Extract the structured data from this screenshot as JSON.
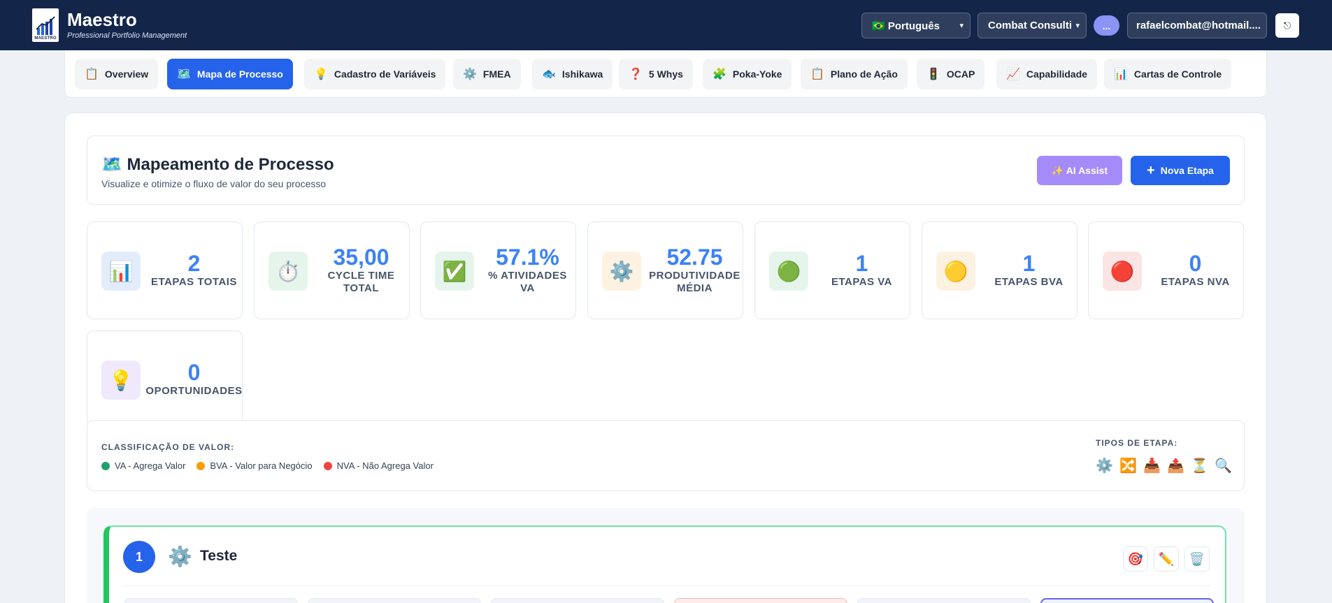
{
  "header": {
    "brand": "Maestro",
    "tagline": "Professional Portfolio Management",
    "logo_text": "MAESTRO",
    "language": "🇧🇷 Português",
    "company": "Combat Consulti",
    "more": "...",
    "email": "rafaelcombat@hotmail....",
    "logout_icon": "⎋"
  },
  "tabs": [
    {
      "icon": "📋",
      "label": "Overview"
    },
    {
      "icon": "🗺️",
      "label": "Mapa de Processo"
    },
    {
      "icon": "💡",
      "label": "Cadastro de Variáveis"
    },
    {
      "icon": "⚙️",
      "label": "FMEA"
    },
    {
      "icon": "🐟",
      "label": "Ishikawa"
    },
    {
      "icon": "❓",
      "label": "5 Whys"
    },
    {
      "icon": "🧩",
      "label": "Poka-Yoke"
    },
    {
      "icon": "📋",
      "label": "Plano de Ação"
    },
    {
      "icon": "🚦",
      "label": "OCAP"
    },
    {
      "icon": "📈",
      "label": "Capabilidade"
    },
    {
      "icon": "📊",
      "label": "Cartas de Controle"
    }
  ],
  "hero": {
    "title": "🗺️ Mapeamento de Processo",
    "subtitle": "Visualize e otimize o fluxo de valor do seu processo",
    "ai_button": "✨ AI Assist",
    "new_button_icon": "+",
    "new_button": "Nova Etapa"
  },
  "stats": [
    {
      "icon": "📊",
      "value": "2",
      "label": "ETAPAS TOTAIS"
    },
    {
      "icon": "⏱️",
      "value": "35,00",
      "label": "CYCLE TIME TOTAL"
    },
    {
      "icon": "✅",
      "value": "57.1%",
      "label": "% ATIVIDADES VA"
    },
    {
      "icon": "⚙️",
      "value": "52.75",
      "label": "PRODUTIVIDADE MÉDIA"
    },
    {
      "icon": "🟢",
      "value": "1",
      "label": "ETAPAS VA"
    },
    {
      "icon": "🟡",
      "value": "1",
      "label": "ETAPAS BVA"
    },
    {
      "icon": "🔴",
      "value": "0",
      "label": "ETAPAS NVA"
    },
    {
      "icon": "💡",
      "value": "0",
      "label": "OPORTUNIDADES"
    }
  ],
  "legend": {
    "title": "CLASSIFICAÇÃO DE VALOR:",
    "items": [
      {
        "label": "VA - Agrega Valor",
        "color": "#22a06b"
      },
      {
        "label": "BVA - Valor para Negócio",
        "color": "#f59e0b"
      },
      {
        "label": "NVA - Não Agrega Valor",
        "color": "#ef4444"
      }
    ],
    "types_title": "TIPOS DE ETAPA:",
    "types": [
      "⚙️",
      "🔀",
      "📥",
      "📤",
      "⏳",
      "🔍"
    ]
  },
  "step": {
    "number": "1",
    "icon": "⚙️",
    "title": "Teste",
    "actions": [
      "🎯",
      "✏️",
      "🗑️"
    ]
  }
}
